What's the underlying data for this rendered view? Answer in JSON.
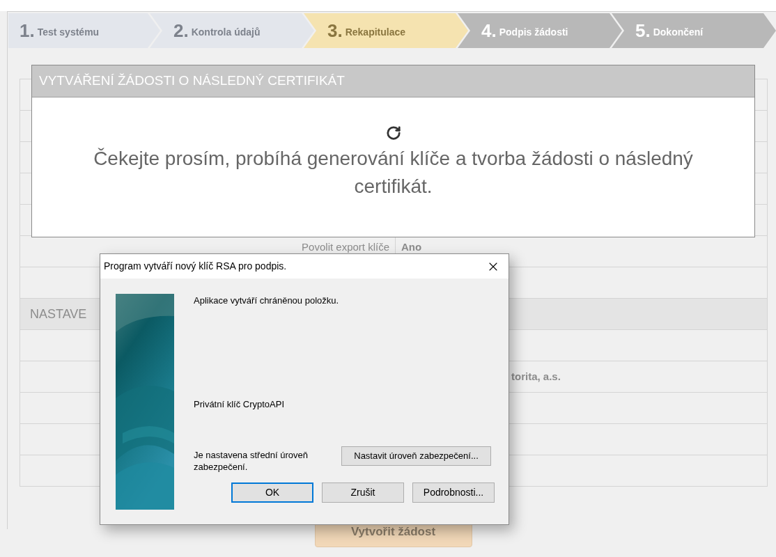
{
  "steps": [
    {
      "number": "1.",
      "label": "Test systému",
      "kind": "done"
    },
    {
      "number": "2.",
      "label": "Kontrola údajů",
      "kind": "done"
    },
    {
      "number": "3.",
      "label": "Rekapitulace",
      "kind": "current"
    },
    {
      "number": "4.",
      "label": "Podpis žádosti",
      "kind": "upcoming"
    },
    {
      "number": "5.",
      "label": "Dokončení",
      "kind": "upcoming"
    }
  ],
  "form": {
    "rows": [
      {
        "kind": "row"
      },
      {
        "kind": "row"
      },
      {
        "kind": "row"
      },
      {
        "kind": "row"
      },
      {
        "kind": "row"
      },
      {
        "kind": "row",
        "label": "Povolit export klíče",
        "value": "Ano"
      },
      {
        "kind": "row"
      },
      {
        "kind": "section",
        "title": "NASTAVE"
      },
      {
        "kind": "row"
      },
      {
        "kind": "row",
        "value_covered": "torita, a.s."
      },
      {
        "kind": "row"
      },
      {
        "kind": "row"
      },
      {
        "kind": "row"
      }
    ],
    "submit": {
      "label": "Vytvořit žádost",
      "disabled": true
    }
  },
  "loading": {
    "title": "VYTVÁŘENÍ ŽÁDOSTI O NÁSLEDNÝ CERTIFIKÁT",
    "message": "Čekejte prosím, probíhá generování klíče a tvorba žádosti o následný certifikát."
  },
  "dialog": {
    "title": "Program vytváří nový klíč RSA pro podpis.",
    "message": "Aplikace vytváří chráněnou položku.",
    "item": "Privátní klíč CryptoAPI",
    "security_text": "Je nastavena střední úroveň zabezpečení.",
    "security_button": "Nastavit úroveň zabezpečení...",
    "buttons": [
      {
        "label": "OK",
        "default": true
      },
      {
        "label": "Zrušit",
        "default": false
      },
      {
        "label": "Podrobnosti...",
        "default": false
      }
    ]
  }
}
